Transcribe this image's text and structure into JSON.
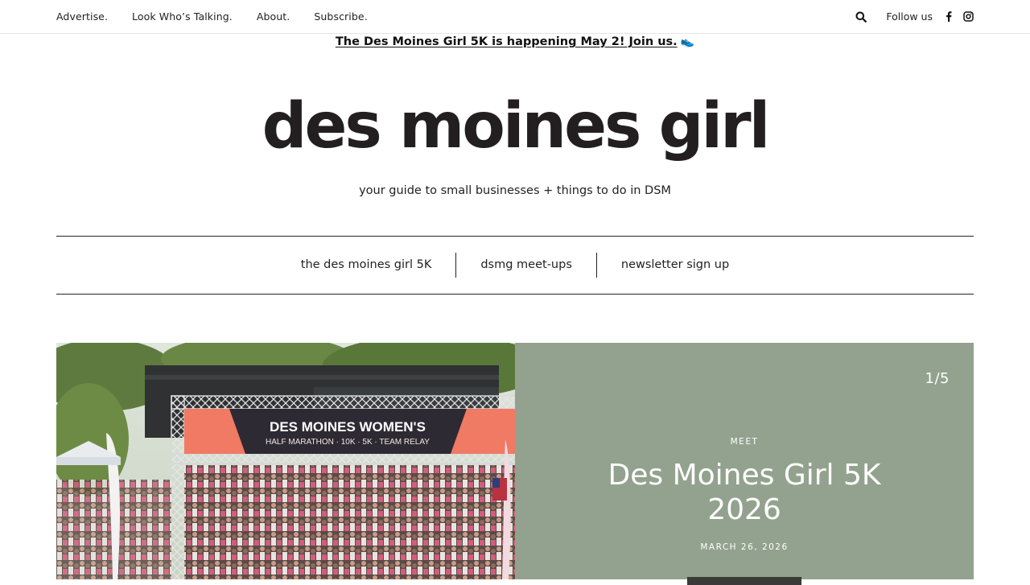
{
  "topbar": {
    "nav": [
      "Advertise.",
      "Look Who’s Talking.",
      "About.",
      "Subscribe."
    ],
    "follow_label": "Follow us",
    "icons": [
      "search-icon",
      "facebook-icon",
      "instagram-icon"
    ]
  },
  "announcement": {
    "text": "The Des Moines Girl 5K is happening May 2! Join us.",
    "emoji": "👟"
  },
  "site": {
    "logo_text": "des moines girl",
    "tagline": "your guide to small businesses + things to do in DSM"
  },
  "main_nav": [
    "the des moines girl 5K",
    "dsmg meet-ups",
    "newsletter sign up"
  ],
  "hero": {
    "photo": {
      "banner_line1": "DES MOINES WOMEN'S",
      "banner_line2": "HALF MARATHON · 10K · 5K · TEAM RELAY"
    },
    "counter": "1/5",
    "category": "MEET",
    "title": "Des Moines Girl 5K 2026",
    "date": "MARCH 26, 2026"
  },
  "colors": {
    "panel_bg": "#92a28e",
    "text_dark": "#222222",
    "banner_coral": "#f07a64",
    "banner_dark": "#2e2a33"
  }
}
